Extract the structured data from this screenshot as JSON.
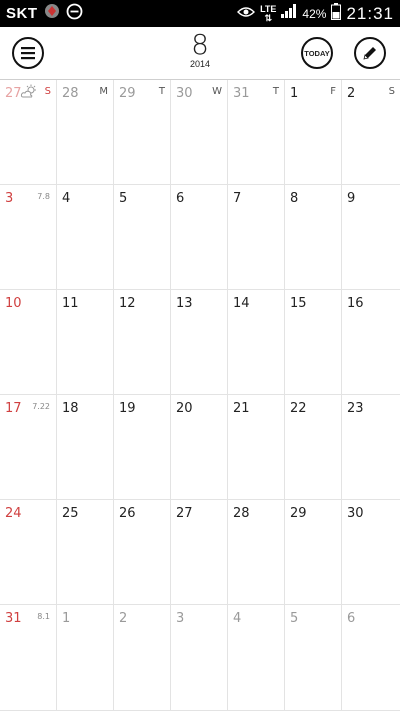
{
  "status_bar": {
    "carrier": "SKT",
    "network": "LTE",
    "battery": "42%",
    "time": "21:31"
  },
  "header": {
    "month": "8",
    "year": "2014",
    "today_label": "TODAY"
  },
  "calendar": {
    "weekday_abbrevs": [
      "S",
      "M",
      "T",
      "W",
      "T",
      "F",
      "S"
    ],
    "weeks": [
      {
        "days": [
          "27",
          "28",
          "29",
          "30",
          "31",
          "1",
          "2"
        ],
        "lunar": ""
      },
      {
        "days": [
          "3",
          "4",
          "5",
          "6",
          "7",
          "8",
          "9"
        ],
        "lunar": "7.8"
      },
      {
        "days": [
          "10",
          "11",
          "12",
          "13",
          "14",
          "15",
          "16"
        ],
        "lunar": ""
      },
      {
        "days": [
          "17",
          "18",
          "19",
          "20",
          "21",
          "22",
          "23"
        ],
        "lunar": "7.22"
      },
      {
        "days": [
          "24",
          "25",
          "26",
          "27",
          "28",
          "29",
          "30"
        ],
        "lunar": ""
      },
      {
        "days": [
          "31",
          "1",
          "2",
          "3",
          "4",
          "5",
          "6"
        ],
        "lunar": "8.1"
      }
    ]
  },
  "colors": {
    "sunday": "#d04040",
    "dim": "#9a9a9a",
    "grid": "#e3e3e3"
  },
  "icons": [
    "menu-icon",
    "pencil-icon",
    "weather-cloud-sun-icon",
    "eye-icon",
    "signal-icon",
    "battery-icon",
    "minus-circle-icon"
  ]
}
